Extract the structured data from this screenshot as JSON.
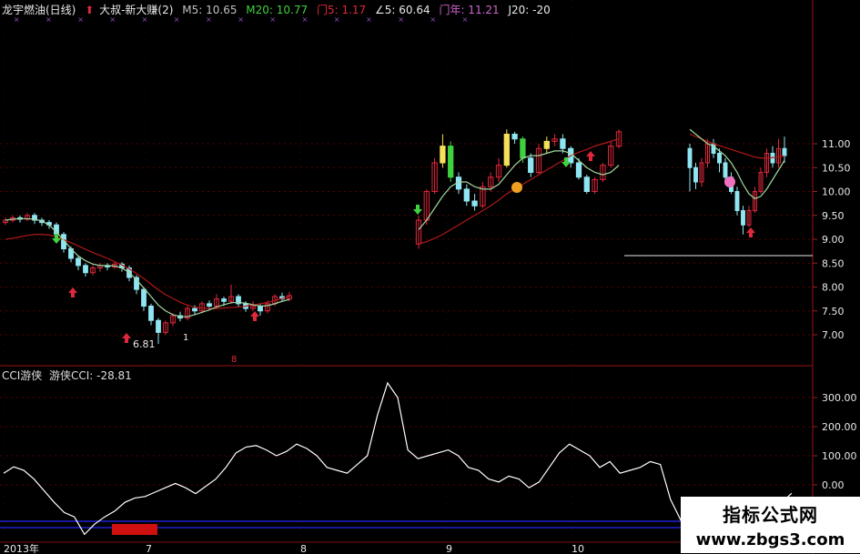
{
  "header": {
    "stock_name": "龙宇燃油(日线)",
    "indicator_name": "大叔-新大赚(2)",
    "m5_label": "M5: 10.65",
    "m20_label": "M20: 10.77",
    "men5_label": "门5: 1.17",
    "angle_label": "∠5: 60.64",
    "men_nian_label": "门年: 11.21",
    "j20_label": "J20: -20"
  },
  "cci_header": {
    "name": "CCI游侠",
    "value_label": "游侠CCI: -28.81"
  },
  "annotations": {
    "low_price": "6.81",
    "marker_1": "1",
    "marker_s": "8"
  },
  "watermark": {
    "line1": "指标公式网",
    "line2": "www.zbgs3.com"
  },
  "colors": {
    "background": "#000000",
    "up_candle": "#e0283c",
    "down_candle": "#8fe6f2",
    "highlight_yellow": "#f5e05a",
    "highlight_green": "#3fd13f",
    "ma_short": "#a0d8a0",
    "ma_long": "#b01818",
    "cci_line": "#ffffff",
    "grid": "#5a0000",
    "axis_text": "#e8e8e8"
  },
  "chart_data": [
    {
      "type": "candlestick",
      "title": "龙宇燃油(日线)",
      "y_ticks": [
        7.0,
        7.5,
        8.0,
        8.5,
        9.0,
        9.5,
        10.0,
        10.5,
        11.0
      ],
      "ylim": [
        6.75,
        11.25
      ],
      "x_labels": [
        "2013年",
        "7",
        "8",
        "9",
        "10"
      ],
      "segments": [
        {
          "name": "before",
          "candles": [
            [
              9.35,
              9.4,
              9.3,
              9.45
            ],
            [
              9.4,
              9.45,
              9.35,
              9.5
            ],
            [
              9.45,
              9.42,
              9.35,
              9.5
            ],
            [
              9.42,
              9.5,
              9.38,
              9.55
            ],
            [
              9.5,
              9.4,
              9.32,
              9.55
            ],
            [
              9.4,
              9.35,
              9.28,
              9.45
            ],
            [
              9.35,
              9.3,
              9.22,
              9.4
            ],
            [
              9.3,
              9.1,
              9.02,
              9.35
            ],
            [
              9.1,
              8.8,
              8.72,
              9.15
            ],
            [
              8.8,
              8.6,
              8.52,
              8.85
            ],
            [
              8.6,
              8.45,
              8.35,
              8.65
            ],
            [
              8.45,
              8.3,
              8.22,
              8.5
            ],
            [
              8.3,
              8.4,
              8.25,
              8.45
            ],
            [
              8.4,
              8.45,
              8.32,
              8.5
            ],
            [
              8.45,
              8.42,
              8.35,
              8.5
            ],
            [
              8.42,
              8.48,
              8.38,
              8.52
            ],
            [
              8.48,
              8.4,
              8.32,
              8.52
            ],
            [
              8.4,
              8.2,
              8.12,
              8.45
            ],
            [
              8.2,
              7.95,
              7.85,
              8.25
            ],
            [
              7.95,
              7.6,
              7.5,
              8.0
            ],
            [
              7.6,
              7.3,
              7.2,
              7.65
            ],
            [
              7.3,
              7.05,
              6.81,
              7.35
            ],
            [
              7.05,
              7.25,
              7.0,
              7.3
            ],
            [
              7.25,
              7.4,
              7.18,
              7.45
            ],
            [
              7.4,
              7.35,
              7.28,
              7.48
            ],
            [
              7.35,
              7.55,
              7.3,
              7.6
            ],
            [
              7.55,
              7.5,
              7.42,
              7.62
            ],
            [
              7.5,
              7.65,
              7.45,
              7.7
            ],
            [
              7.65,
              7.6,
              7.52,
              7.72
            ],
            [
              7.6,
              7.75,
              7.55,
              7.85
            ],
            [
              7.75,
              7.7,
              7.6,
              7.8
            ],
            [
              7.7,
              7.8,
              7.65,
              8.05
            ],
            [
              7.8,
              7.65,
              7.58,
              7.85
            ],
            [
              7.65,
              7.55,
              7.48,
              7.7
            ],
            [
              7.55,
              7.6,
              7.5,
              7.7
            ],
            [
              7.6,
              7.5,
              7.4,
              7.65
            ],
            [
              7.5,
              7.65,
              7.45,
              7.72
            ],
            [
              7.65,
              7.8,
              7.6,
              7.85
            ],
            [
              7.8,
              7.75,
              7.7,
              7.88
            ],
            [
              7.75,
              7.82,
              7.7,
              7.9
            ]
          ],
          "ma_short": [
            9.4,
            9.42,
            9.43,
            9.43,
            9.42,
            9.38,
            9.3,
            9.15,
            8.98,
            8.8,
            8.65,
            8.55,
            8.48,
            8.45,
            8.45,
            8.44,
            8.4,
            8.3,
            8.15,
            7.98,
            7.8,
            7.62,
            7.5,
            7.42,
            7.38,
            7.38,
            7.42,
            7.47,
            7.52,
            7.58,
            7.63,
            7.67,
            7.68,
            7.66,
            7.63,
            7.6,
            7.61,
            7.65,
            7.7,
            7.74
          ],
          "ma_long": [
            9.0,
            9.02,
            9.05,
            9.08,
            9.1,
            9.1,
            9.09,
            9.05,
            8.99,
            8.93,
            8.86,
            8.79,
            8.72,
            8.66,
            8.6,
            8.53,
            8.46,
            8.38,
            8.28,
            8.18,
            8.06,
            7.94,
            7.84,
            7.76,
            7.68,
            7.62,
            7.58,
            7.56,
            7.55,
            7.55,
            7.56,
            7.57,
            7.58,
            7.6,
            7.62,
            7.65,
            7.68,
            7.72,
            7.76,
            7.8
          ]
        },
        {
          "name": "after",
          "candles": [
            [
              8.9,
              9.4,
              8.8,
              9.5
            ],
            [
              9.4,
              10.0,
              9.3,
              10.05
            ],
            [
              10.0,
              10.6,
              9.95,
              10.7
            ],
            [
              10.6,
              10.95,
              10.5,
              11.2
            ],
            [
              10.95,
              10.3,
              10.2,
              11.05
            ],
            [
              10.3,
              10.05,
              9.95,
              10.4
            ],
            [
              10.05,
              9.8,
              9.7,
              10.15
            ],
            [
              9.8,
              9.7,
              9.6,
              9.95
            ],
            [
              9.7,
              10.1,
              9.65,
              10.2
            ],
            [
              10.1,
              10.3,
              10.0,
              10.4
            ],
            [
              10.3,
              10.55,
              10.2,
              10.7
            ],
            [
              10.55,
              11.2,
              10.5,
              11.3
            ],
            [
              11.2,
              11.1,
              11.0,
              11.25
            ],
            [
              11.1,
              10.7,
              10.6,
              11.15
            ],
            [
              10.7,
              10.4,
              10.3,
              10.8
            ],
            [
              10.4,
              10.9,
              10.35,
              11.0
            ],
            [
              10.9,
              11.05,
              10.8,
              11.15
            ],
            [
              11.05,
              11.1,
              10.95,
              11.2
            ],
            [
              11.1,
              10.9,
              10.8,
              11.2
            ],
            [
              10.9,
              10.6,
              10.5,
              10.95
            ],
            [
              10.6,
              10.3,
              10.25,
              10.7
            ],
            [
              10.3,
              10.0,
              9.95,
              10.35
            ],
            [
              10.0,
              10.25,
              9.95,
              10.3
            ],
            [
              10.25,
              10.55,
              10.2,
              10.6
            ],
            [
              10.55,
              10.95,
              10.5,
              11.05
            ],
            [
              10.95,
              11.25,
              10.9,
              11.3
            ]
          ],
          "ma_short": [
            9.2,
            9.4,
            9.65,
            9.9,
            10.1,
            10.2,
            10.2,
            10.1,
            10.05,
            10.05,
            10.15,
            10.35,
            10.55,
            10.7,
            10.75,
            10.75,
            10.8,
            10.85,
            10.85,
            10.8,
            10.65,
            10.5,
            10.4,
            10.35,
            10.4,
            10.55
          ],
          "ma_long": [
            8.9,
            8.95,
            9.02,
            9.1,
            9.2,
            9.3,
            9.4,
            9.5,
            9.6,
            9.7,
            9.82,
            9.95,
            10.05,
            10.15,
            10.25,
            10.35,
            10.45,
            10.55,
            10.65,
            10.75,
            10.82,
            10.88,
            10.95,
            11.0,
            11.05,
            11.1
          ]
        },
        {
          "name": "recent",
          "candles": [
            [
              10.9,
              10.5,
              10.0,
              11.0
            ],
            [
              10.5,
              10.2,
              10.05,
              10.6
            ],
            [
              10.2,
              10.6,
              10.1,
              10.7
            ],
            [
              10.6,
              11.0,
              10.5,
              11.1
            ],
            [
              11.0,
              10.8,
              10.7,
              11.1
            ],
            [
              10.8,
              10.6,
              10.4,
              10.9
            ],
            [
              10.6,
              10.3,
              10.2,
              10.7
            ],
            [
              10.3,
              10.0,
              9.95,
              10.4
            ],
            [
              10.0,
              9.6,
              9.5,
              10.1
            ],
            [
              9.6,
              9.3,
              9.1,
              9.7
            ],
            [
              9.3,
              9.6,
              9.25,
              9.7
            ],
            [
              9.6,
              10.0,
              9.55,
              10.1
            ],
            [
              10.0,
              10.4,
              9.95,
              10.5
            ],
            [
              10.4,
              10.8,
              10.3,
              10.9
            ],
            [
              10.8,
              10.6,
              10.5,
              10.95
            ],
            [
              10.6,
              10.9,
              10.5,
              11.1
            ],
            [
              10.9,
              10.75,
              10.6,
              11.15
            ]
          ],
          "ma_short": [
            11.3,
            11.2,
            11.1,
            11.0,
            10.95,
            10.85,
            10.75,
            10.6,
            10.4,
            10.15,
            9.95,
            9.85,
            9.9,
            10.05,
            10.25,
            10.45,
            10.65
          ],
          "ma_long": [
            11.2,
            11.15,
            11.1,
            11.05,
            11.0,
            10.96,
            10.92,
            10.88,
            10.84,
            10.8,
            10.76,
            10.72,
            10.7,
            10.7,
            10.71,
            10.72,
            10.74
          ]
        }
      ]
    },
    {
      "type": "line",
      "title": "CCI游侠",
      "y_ticks": [
        0,
        100,
        200,
        300
      ],
      "ylim": [
        -230,
        360
      ],
      "series": [
        {
          "name": "游侠CCI",
          "values": [
            40,
            62,
            50,
            20,
            -20,
            -60,
            -95,
            -110,
            -170,
            -135,
            -110,
            -90,
            -60,
            -45,
            -40,
            -25,
            -10,
            5,
            -10,
            -30,
            -5,
            20,
            60,
            110,
            130,
            135,
            120,
            100,
            115,
            140,
            125,
            100,
            60,
            50,
            40,
            70,
            100,
            240,
            350,
            300,
            120,
            90,
            100,
            110,
            120,
            100,
            60,
            50,
            20,
            10,
            30,
            20,
            -10,
            10,
            60,
            110,
            140,
            120,
            100,
            60,
            80,
            40,
            50,
            60,
            80,
            70,
            -50,
            -120,
            -200,
            -140,
            -110,
            -160,
            -150,
            -140,
            -130,
            -120,
            -100,
            -60,
            -28.81
          ]
        }
      ]
    }
  ]
}
